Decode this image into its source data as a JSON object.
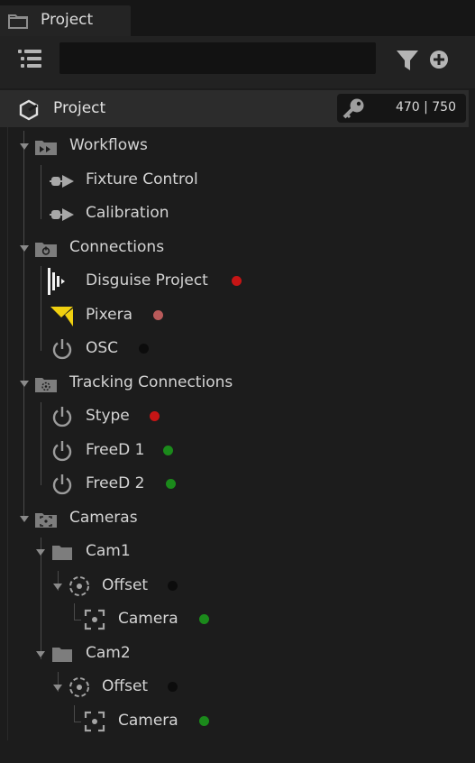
{
  "tab": {
    "label": "Project"
  },
  "toolbar": {
    "search_value": ""
  },
  "root": {
    "label": "Project",
    "counter": "470 | 750"
  },
  "tree": {
    "workflows": "Workflows",
    "fixture_control": "Fixture Control",
    "calibration": "Calibration",
    "connections": "Connections",
    "disguise": "Disguise Project",
    "pixera": "Pixera",
    "osc": "OSC",
    "tracking": "Tracking Connections",
    "stype": "Stype",
    "freed1": "FreeD 1",
    "freed2": "FreeD 2",
    "cameras": "Cameras",
    "cam1": "Cam1",
    "cam1_offset": "Offset",
    "cam1_camera": "Camera",
    "cam2": "Cam2",
    "cam2_offset": "Offset",
    "cam2_camera": "Camera"
  },
  "status_colors": {
    "disguise": "#c61515",
    "pixera": "#b85a5a",
    "osc": "#0c0c0c",
    "stype": "#c61515",
    "freed1": "#1b8a1b",
    "freed2": "#1b8a1b",
    "cam1_offset": "#0c0c0c",
    "cam1_camera": "#1b8a1b",
    "cam2_offset": "#0c0c0c",
    "cam2_camera": "#1b8a1b"
  },
  "icons": {
    "tab": "folder-icon",
    "toolbar": [
      "list-icon",
      "filter-icon",
      "add-icon"
    ],
    "root": "hexagon-icon",
    "counter": "key-icon",
    "folders": [
      "workflow-folder-icon",
      "connection-folder-icon",
      "tracking-folder-icon",
      "camera-folder-icon",
      "folder-icon"
    ],
    "items": [
      "fixture-control-icon",
      "calibration-icon",
      "disguise-icon",
      "pixera-icon",
      "power-icon",
      "offset-icon",
      "camera-icon"
    ]
  }
}
